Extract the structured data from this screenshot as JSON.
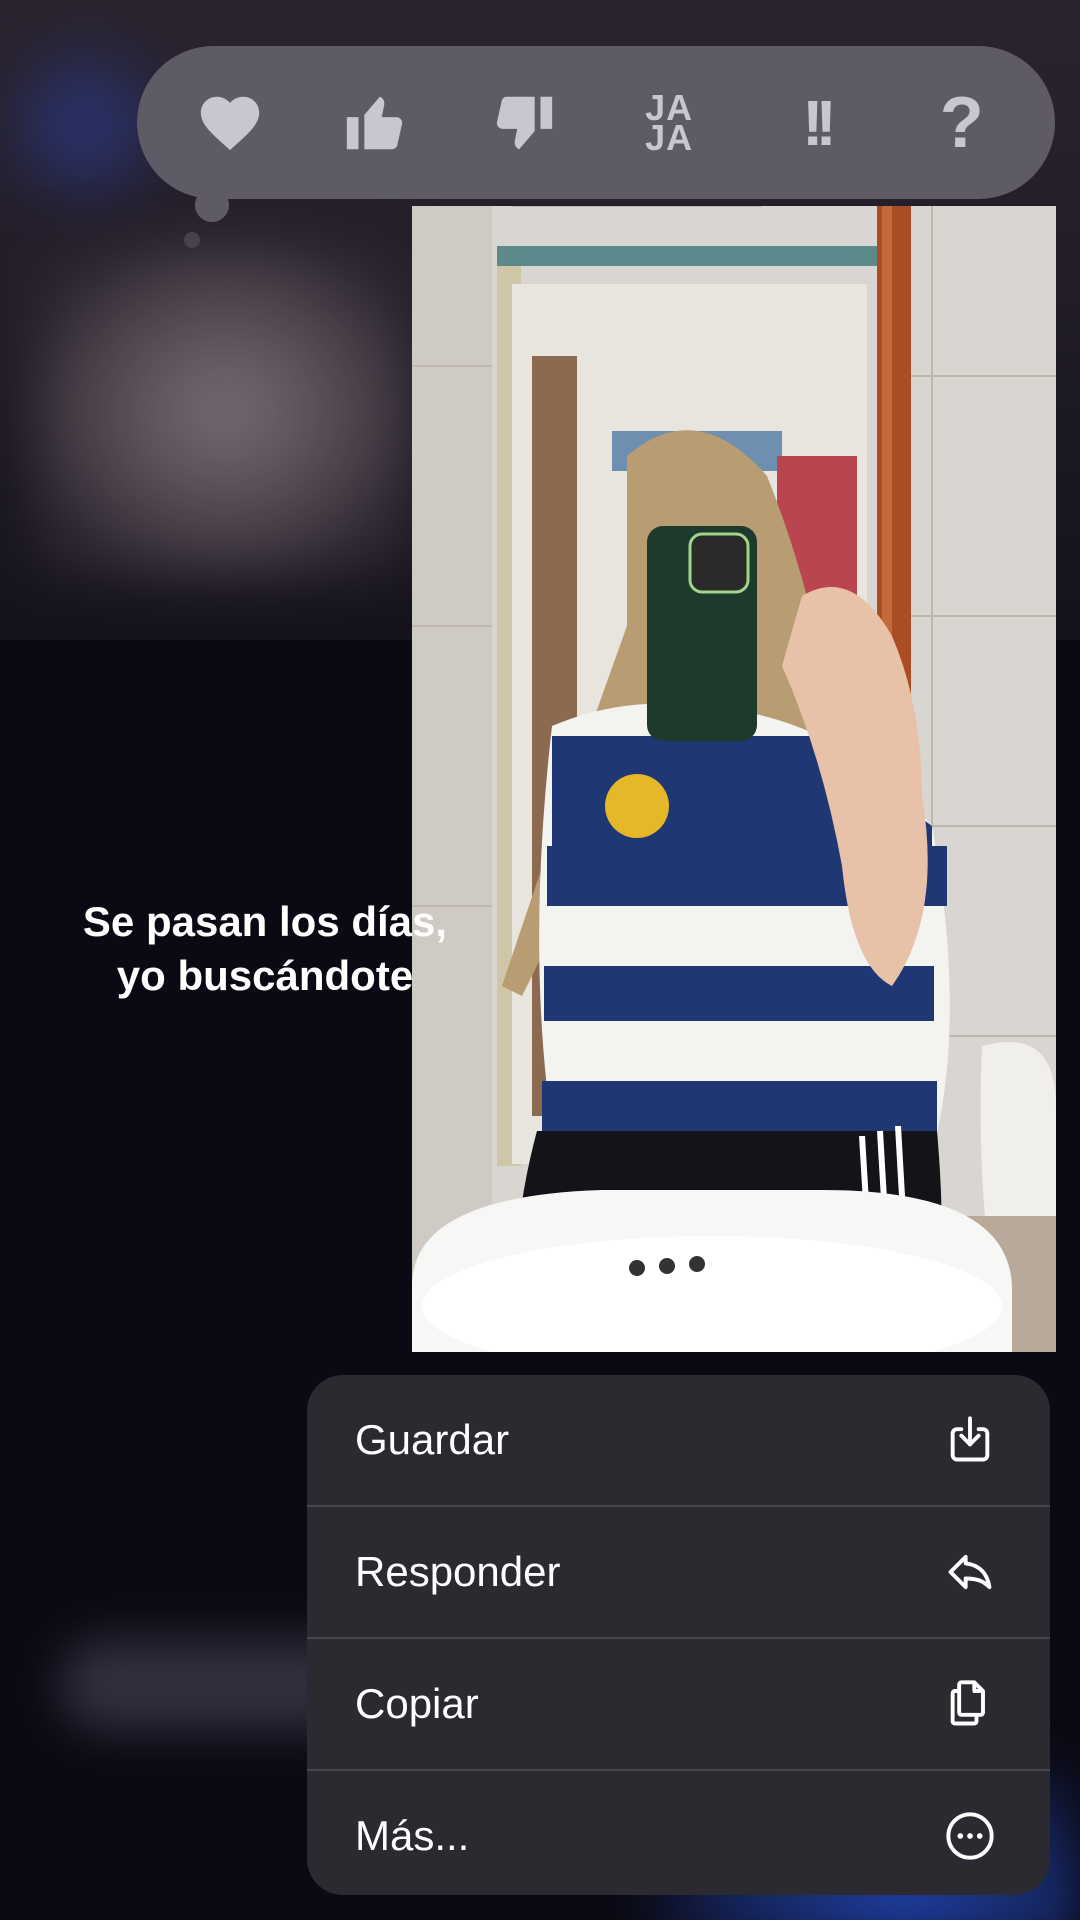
{
  "reactions": [
    {
      "name": "heart-icon"
    },
    {
      "name": "thumbs-up-icon"
    },
    {
      "name": "thumbs-down-icon"
    },
    {
      "name": "haha-icon",
      "text_top": "JA",
      "text_bottom": "JA"
    },
    {
      "name": "emphasis-icon",
      "text": "!!"
    },
    {
      "name": "question-icon",
      "text": "?"
    }
  ],
  "caption": {
    "line1": "Se pasan los días,",
    "line2": "yo buscándote"
  },
  "menu": {
    "items": [
      {
        "label": "Guardar",
        "icon": "download-icon"
      },
      {
        "label": "Responder",
        "icon": "reply-icon"
      },
      {
        "label": "Copiar",
        "icon": "copy-icon"
      },
      {
        "label": "Más...",
        "icon": "more-icon"
      }
    ]
  },
  "colors": {
    "reaction_bar": "#5f5b66",
    "reaction_icon": "#c9c6cf",
    "menu_bg": "#2b2a30",
    "menu_text": "#ffffff"
  }
}
